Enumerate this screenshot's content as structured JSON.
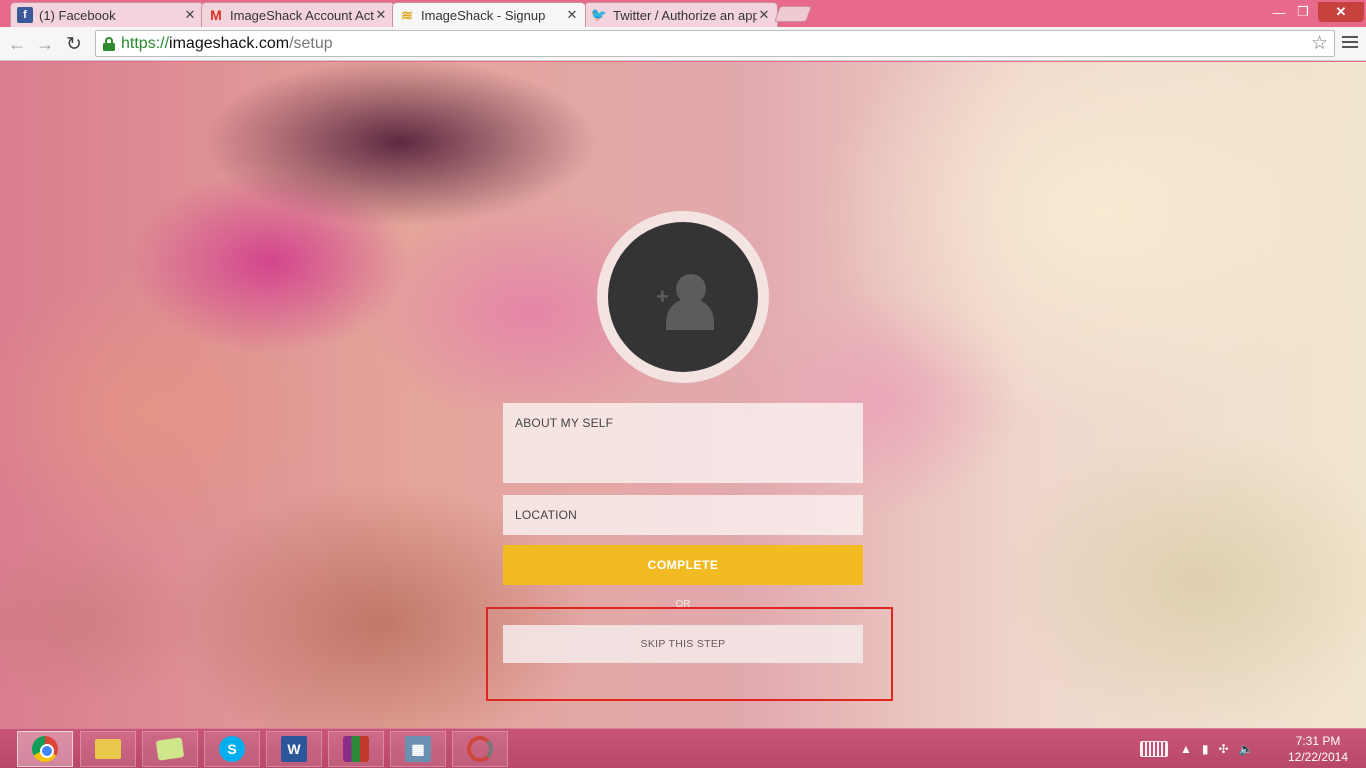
{
  "browser": {
    "tabs": [
      {
        "title": "(1) Facebook",
        "favicon": "facebook-icon",
        "color": "#3b5998",
        "active": false
      },
      {
        "title": "ImageShack Account Acti",
        "favicon": "gmail-icon",
        "color": "#d93025",
        "active": false
      },
      {
        "title": "ImageShack - Signup",
        "favicon": "imageshack-icon",
        "color": "#f2bb24",
        "active": true
      },
      {
        "title": "Twitter / Authorize an app",
        "favicon": "twitter-icon",
        "color": "#1da1f2",
        "active": false
      }
    ],
    "address_bar": {
      "scheme": "https://",
      "host": "imageshack.com",
      "path": "/setup"
    }
  },
  "page": {
    "avatar_icon": "user-add-icon",
    "about_placeholder": "ABOUT MY SELF",
    "location_placeholder": "LOCATION",
    "complete_label": "COMPLETE",
    "or_label": "OR",
    "skip_label": "SKIP THIS STEP",
    "accent_color": "#f2bb24",
    "highlight_color": "#e0241e"
  },
  "taskbar": {
    "apps": [
      "chrome-icon",
      "explorer-icon",
      "stickynotes-icon",
      "skype-icon",
      "word-icon",
      "winrar-icon",
      "calculator-icon",
      "recorder-icon"
    ],
    "clock": {
      "time": "7:31 PM",
      "date": "12/22/2014"
    }
  }
}
